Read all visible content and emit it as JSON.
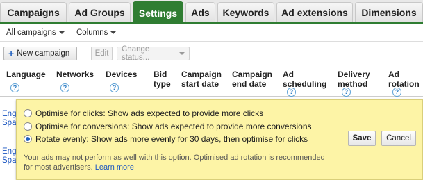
{
  "tabs": [
    {
      "label": "Campaigns",
      "active": false
    },
    {
      "label": "Ad Groups",
      "active": false
    },
    {
      "label": "Settings",
      "active": true
    },
    {
      "label": "Ads",
      "active": false
    },
    {
      "label": "Keywords",
      "active": false
    },
    {
      "label": "Ad extensions",
      "active": false
    },
    {
      "label": "Dimensions",
      "active": false
    }
  ],
  "filters": {
    "all_campaigns": "All campaigns",
    "columns": "Columns"
  },
  "actions": {
    "new_campaign": "New campaign",
    "edit": "Edit",
    "change_status": "Change status..."
  },
  "columns": {
    "language": "Language",
    "networks": "Networks",
    "devices": "Devices",
    "bid_type": [
      "Bid",
      "type"
    ],
    "campaign_start": [
      "Campaign",
      "start date"
    ],
    "campaign_end": [
      "Campaign",
      "end date"
    ],
    "ad_scheduling": [
      "Ad",
      "scheduling"
    ],
    "delivery_method": [
      "Delivery",
      "method"
    ],
    "ad_rotation": [
      "Ad",
      "rotation"
    ]
  },
  "rows": [
    {
      "language_lines": [
        "Eng",
        "Spa"
      ]
    },
    {
      "language_lines": [
        "Eng",
        "Spa"
      ]
    }
  ],
  "popup": {
    "options": [
      {
        "label": "Optimise for clicks: Show ads expected to provide more clicks",
        "checked": false
      },
      {
        "label": "Optimise for conversions: Show ads expected to provide more conversions",
        "checked": false
      },
      {
        "label": "Rotate evenly: Show ads more evenly for 30 days, then optimise for clicks",
        "checked": true
      }
    ],
    "save": "Save",
    "cancel": "Cancel",
    "note": "Your ads may not perform as well with this option. Optimised ad rotation is recommended for most advertisers.",
    "learn_more": "Learn more"
  },
  "colors": {
    "active_tab": "#2f7d32",
    "popup_bg": "#fdf4a6",
    "link": "#1a55c0"
  }
}
